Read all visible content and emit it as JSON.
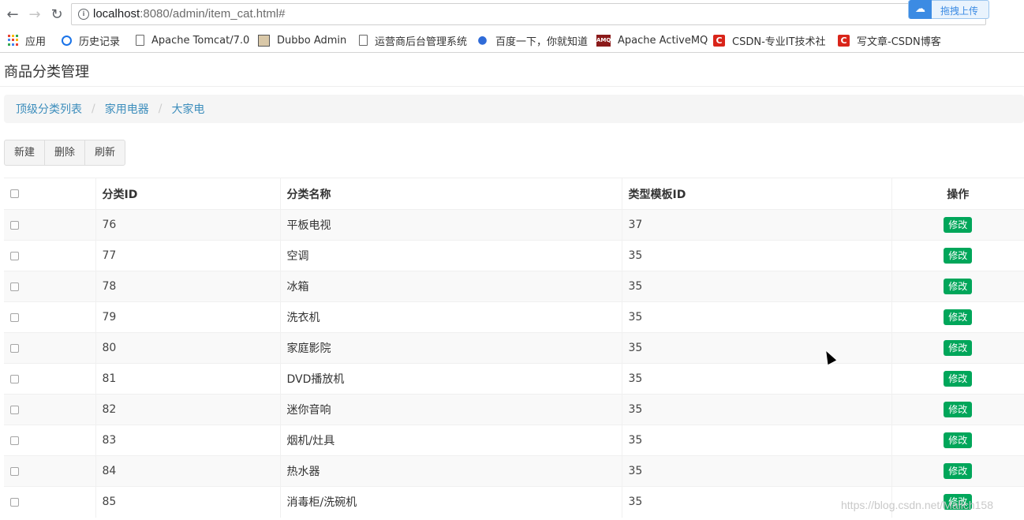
{
  "browser": {
    "url_host": "localhost",
    "url_rest": ":8080/admin/item_cat.html#",
    "upload_label": "拖拽上传",
    "bookmarks": [
      {
        "label": "应用",
        "icon": "apps-grid-icon"
      },
      {
        "label": "历史记录",
        "icon": "history-icon"
      },
      {
        "label": "Apache Tomcat/7.0",
        "icon": "page-icon"
      },
      {
        "label": "Dubbo Admin",
        "icon": "image-icon"
      },
      {
        "label": "运营商后台管理系统",
        "icon": "page-icon"
      },
      {
        "label": "百度一下，你就知道",
        "icon": "baidu-paw-icon"
      },
      {
        "label": "Apache ActiveMQ",
        "icon": "activemq-icon"
      },
      {
        "label": "CSDN-专业IT技术社",
        "icon": "csdn-icon"
      },
      {
        "label": "写文章-CSDN博客",
        "icon": "csdn-icon"
      }
    ]
  },
  "page": {
    "title": "商品分类管理",
    "breadcrumb": [
      "顶级分类列表",
      "家用电器",
      "大家电"
    ],
    "toolbar": {
      "new": "新建",
      "delete": "删除",
      "refresh": "刷新"
    }
  },
  "table": {
    "headers": {
      "id": "分类ID",
      "name": "分类名称",
      "template": "类型模板ID",
      "ops": "操作"
    },
    "edit_label": "修改",
    "rows": [
      {
        "id": "76",
        "name": "平板电视",
        "template": "37"
      },
      {
        "id": "77",
        "name": "空调",
        "template": "35"
      },
      {
        "id": "78",
        "name": "冰箱",
        "template": "35"
      },
      {
        "id": "79",
        "name": "洗衣机",
        "template": "35"
      },
      {
        "id": "80",
        "name": "家庭影院",
        "template": "35"
      },
      {
        "id": "81",
        "name": "DVD播放机",
        "template": "35"
      },
      {
        "id": "82",
        "name": "迷你音响",
        "template": "35"
      },
      {
        "id": "83",
        "name": "烟机/灶具",
        "template": "35"
      },
      {
        "id": "84",
        "name": "热水器",
        "template": "35"
      },
      {
        "id": "85",
        "name": "消毒柜/洗碗机",
        "template": "35"
      }
    ]
  },
  "watermark": "https://blog.csdn.net/Mallch158",
  "colors": {
    "link": "#3c8dbc",
    "edit_button": "#00a65a"
  }
}
